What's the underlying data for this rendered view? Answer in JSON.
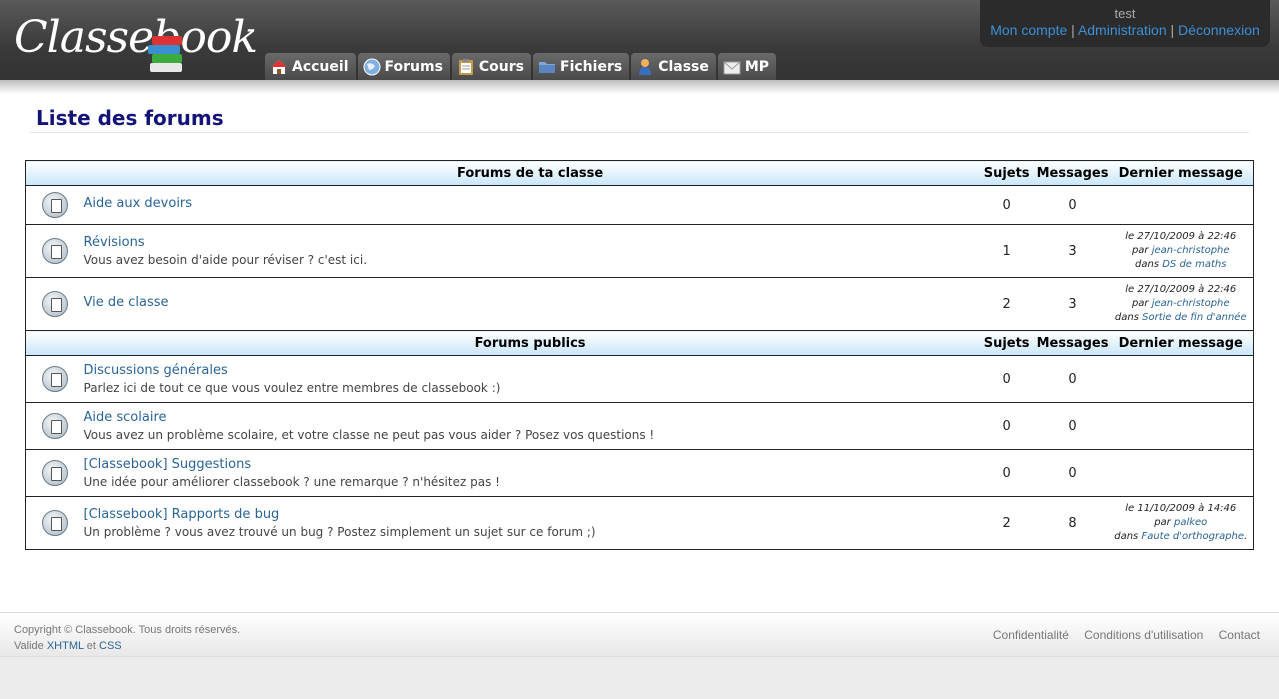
{
  "header": {
    "logo_text": "Classebook",
    "nav": [
      {
        "label": "Accueil",
        "icon": "home-icon"
      },
      {
        "label": "Forums",
        "icon": "globe-icon"
      },
      {
        "label": "Cours",
        "icon": "clipboard-icon"
      },
      {
        "label": "Fichiers",
        "icon": "folder-icon"
      },
      {
        "label": "Classe",
        "icon": "person-icon"
      },
      {
        "label": "MP",
        "icon": "envelope-icon"
      }
    ],
    "user": {
      "name": "test",
      "links": [
        "Mon compte",
        "Administration",
        "Déconnexion"
      ],
      "separator": "|"
    }
  },
  "main": {
    "title": "Liste des forums",
    "sections": [
      {
        "heading": "Forums de ta classe",
        "col_subjects": "Sujets",
        "col_messages": "Messages",
        "col_last": "Dernier message",
        "forums": [
          {
            "name": "Aide aux devoirs",
            "desc": "",
            "subjects": "0",
            "messages": "0",
            "last": null
          },
          {
            "name": "Révisions",
            "desc": "Vous avez besoin d'aide pour réviser ? c'est ici.",
            "subjects": "1",
            "messages": "3",
            "last": {
              "date": "le 27/10/2009 à 22:46",
              "by_prefix": "par",
              "by": "jean-christophe",
              "in_prefix": "dans",
              "in": "DS de maths",
              "suffix": ""
            }
          },
          {
            "name": "Vie de classe",
            "desc": "",
            "subjects": "2",
            "messages": "3",
            "last": {
              "date": "le 27/10/2009 à 22:46",
              "by_prefix": "par",
              "by": "jean-christophe",
              "in_prefix": "dans",
              "in": "Sortie de fin d'année",
              "suffix": ""
            }
          }
        ]
      },
      {
        "heading": "Forums publics",
        "col_subjects": "Sujets",
        "col_messages": "Messages",
        "col_last": "Dernier message",
        "forums": [
          {
            "name": "Discussions générales",
            "desc": "Parlez ici de tout ce que vous voulez entre membres de classebook :)",
            "subjects": "0",
            "messages": "0",
            "last": null
          },
          {
            "name": "Aide scolaire",
            "desc": "Vous avez un problème scolaire, et votre classe ne peut pas vous aider ? Posez vos questions !",
            "subjects": "0",
            "messages": "0",
            "last": null
          },
          {
            "name": "[Classebook] Suggestions",
            "desc": "Une idée pour améliorer classebook ? une remarque ? n'hésitez pas !",
            "subjects": "0",
            "messages": "0",
            "last": null
          },
          {
            "name": "[Classebook] Rapports de bug",
            "desc": "Un problème ? vous avez trouvé un bug ? Postez simplement un sujet sur ce forum ;)",
            "subjects": "2",
            "messages": "8",
            "last": {
              "date": "le 11/10/2009 à 14:46",
              "by_prefix": "par",
              "by": "palkeo",
              "in_prefix": "dans",
              "in": "Faute d'orthographe",
              "suffix": "."
            }
          }
        ]
      }
    ]
  },
  "footer": {
    "copyright": "Copyright © Classebook. Tous droits réservés.",
    "valid_prefix": "Valide",
    "valid_xhtml": "XHTML",
    "valid_and": "et",
    "valid_css": "CSS",
    "links": [
      "Confidentialité",
      "Conditions d'utilisation",
      "Contact"
    ]
  }
}
